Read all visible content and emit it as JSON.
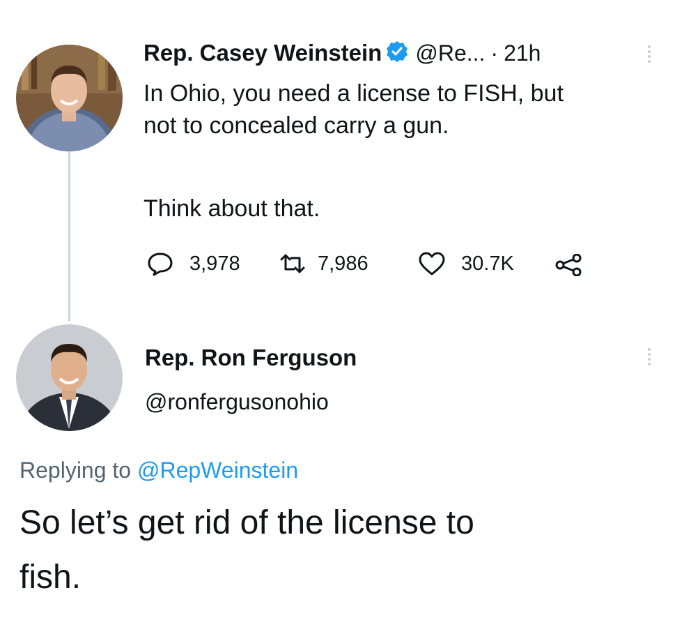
{
  "tweet": {
    "author_name": "Rep. Casey Weinstein",
    "handle": "@Re...",
    "separator": "·",
    "time": "21h",
    "text_line1": "In Ohio, you need a license to FISH, but",
    "text_line2": "not to concealed carry a gun.",
    "text_line3": "Think about that.",
    "replies": "3,978",
    "retweets": "7,986",
    "likes": "30.7K"
  },
  "reply": {
    "author_name": "Rep. Ron Ferguson",
    "handle": "@ronfergusonohio",
    "replying_prefix": "Replying to",
    "replying_to": "@RepWeinstein",
    "text_line1": "So let’s get rid of the license to",
    "text_line2": "fish."
  },
  "colors": {
    "link": "#1d9bf0",
    "verified": "#1d9bf0",
    "text": "#0f1419",
    "muted": "#536471"
  },
  "icons": [
    "verified-badge-icon",
    "reply-icon",
    "retweet-icon",
    "like-icon",
    "share-icon",
    "more-options-icon"
  ]
}
